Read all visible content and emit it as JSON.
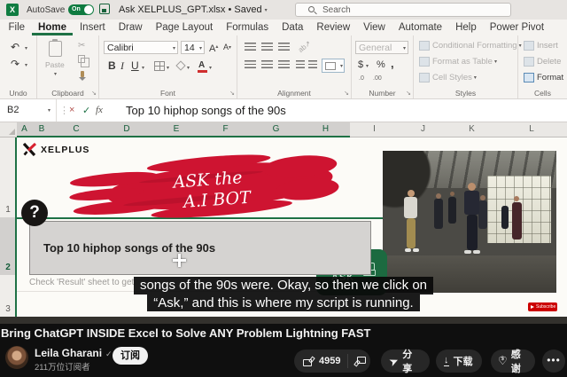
{
  "titlebar": {
    "autosave_label": "AutoSave",
    "autosave_state": "On",
    "doc_title": "Ask XELPLUS_GPT.xlsx",
    "doc_status": " • Saved",
    "search_placeholder": "Search"
  },
  "menu": {
    "tabs": [
      "File",
      "Home",
      "Insert",
      "Draw",
      "Page Layout",
      "Formulas",
      "Data",
      "Review",
      "View",
      "Automate",
      "Help",
      "Power Pivot"
    ],
    "active_tab": "Home"
  },
  "ribbon": {
    "groups": {
      "undo": "Undo",
      "clipboard": "Clipboard",
      "font": "Font",
      "alignment": "Alignment",
      "number": "Number",
      "styles": "Styles",
      "cells": "Cells"
    },
    "paste_label": "Paste",
    "font_name": "Calibri",
    "font_size": "14",
    "bold": "B",
    "italic": "I",
    "underline": "U",
    "letter_a": "A",
    "number_format": "General",
    "number_symbols": {
      "dollar": "$",
      "percent": "%",
      "comma": ","
    },
    "decimals": [
      ".0",
      ".00"
    ],
    "styles_items": [
      "Conditional Formatting",
      "Format as Table",
      "Cell Styles"
    ],
    "cells_items": [
      "Insert",
      "Delete",
      "Format"
    ]
  },
  "formula_bar": {
    "cell_ref": "B2",
    "fx_label": "fx",
    "formula": "Top 10 hiphop songs of the 90s"
  },
  "sheet": {
    "columns": [
      "A",
      "B",
      "C",
      "D",
      "E",
      "F",
      "G",
      "H",
      "I",
      "J",
      "K",
      "L"
    ],
    "rows": [
      "1",
      "2",
      "3"
    ],
    "logo_text": "XELPLUS",
    "banner_line1": "ASK the",
    "banner_line2": "A.I BOT",
    "qmark": "?",
    "textbox_text": "Top 10 hiphop songs of the 90s",
    "ask_button_label": "ASK",
    "row3_note": "Check 'Result' sheet to get",
    "subscribe_badge": "Subscribe"
  },
  "subtitles": {
    "line1": "songs of the 90s were. Okay, so then we click on",
    "line2": "“Ask,” and this is where my script is running."
  },
  "youtube": {
    "video_title": "Bring ChatGPT INSIDE Excel to Solve ANY Problem Lightning FAST",
    "channel_name": "Leila Gharani",
    "subscriber_count": "211万位订阅者",
    "subscribe_label": "订阅",
    "like_count": "4959",
    "share_label": "分享",
    "download_label": "下载",
    "thanks_label": "感谢"
  },
  "colors": {
    "excel_green": "#217346",
    "brush_red": "#ce1431",
    "youtube_red": "#cc0000"
  }
}
